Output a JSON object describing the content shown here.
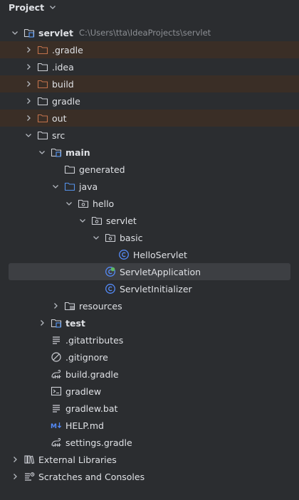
{
  "header": {
    "title": "Project"
  },
  "tree": [
    {
      "label": "servlet",
      "path": "C:\\Users\\tta\\IdeaProjects\\servlet",
      "icon": "module-folder-icon",
      "level": 0,
      "arrow": "open",
      "bold": true
    },
    {
      "label": ".gradle",
      "icon": "excluded-folder-icon",
      "level": 1,
      "arrow": "closed",
      "excluded": true
    },
    {
      "label": ".idea",
      "icon": "folder-icon",
      "level": 1,
      "arrow": "closed"
    },
    {
      "label": "build",
      "icon": "excluded-folder-icon",
      "level": 1,
      "arrow": "closed",
      "excluded": true
    },
    {
      "label": "gradle",
      "icon": "folder-icon",
      "level": 1,
      "arrow": "closed"
    },
    {
      "label": "out",
      "icon": "excluded-folder-icon",
      "level": 1,
      "arrow": "closed",
      "excluded": true
    },
    {
      "label": "src",
      "icon": "folder-icon",
      "level": 1,
      "arrow": "open"
    },
    {
      "label": "main",
      "icon": "module-folder-icon",
      "level": 2,
      "arrow": "open",
      "bold": true
    },
    {
      "label": "generated",
      "icon": "folder-icon",
      "level": 3,
      "arrow": "none"
    },
    {
      "label": "java",
      "icon": "source-folder-icon",
      "level": 3,
      "arrow": "open"
    },
    {
      "label": "hello",
      "icon": "package-icon",
      "level": 4,
      "arrow": "open"
    },
    {
      "label": "servlet",
      "icon": "package-icon",
      "level": 5,
      "arrow": "open"
    },
    {
      "label": "basic",
      "icon": "package-icon",
      "level": 6,
      "arrow": "open"
    },
    {
      "label": "HelloServlet",
      "icon": "class-icon",
      "level": 7,
      "arrow": "none"
    },
    {
      "label": "ServletApplication",
      "icon": "spring-boot-class-icon",
      "level": 6,
      "arrow": "none",
      "selected": true
    },
    {
      "label": "ServletInitializer",
      "icon": "class-icon",
      "level": 6,
      "arrow": "none"
    },
    {
      "label": "resources",
      "icon": "resources-folder-icon",
      "level": 3,
      "arrow": "closed"
    },
    {
      "label": "test",
      "icon": "module-folder-icon",
      "level": 2,
      "arrow": "closed",
      "bold": true
    },
    {
      "label": ".gitattributes",
      "icon": "text-file-icon",
      "level": 2,
      "arrow": "none"
    },
    {
      "label": ".gitignore",
      "icon": "gitignore-icon",
      "level": 2,
      "arrow": "none"
    },
    {
      "label": "build.gradle",
      "icon": "gradle-icon",
      "level": 2,
      "arrow": "none"
    },
    {
      "label": "gradlew",
      "icon": "terminal-file-icon",
      "level": 2,
      "arrow": "none"
    },
    {
      "label": "gradlew.bat",
      "icon": "text-file-icon",
      "level": 2,
      "arrow": "none"
    },
    {
      "label": "HELP.md",
      "icon": "markdown-icon",
      "level": 2,
      "arrow": "none"
    },
    {
      "label": "settings.gradle",
      "icon": "gradle-icon",
      "level": 2,
      "arrow": "none"
    },
    {
      "label": "External Libraries",
      "icon": "libraries-icon",
      "level": 0,
      "arrow": "closed"
    },
    {
      "label": "Scratches and Consoles",
      "icon": "scratches-icon",
      "level": 0,
      "arrow": "closed"
    }
  ],
  "colors": {
    "excluded_bg": "#3a2e26",
    "selected_bg": "#3d3f43",
    "excluded_folder": "#c2724c",
    "source_folder": "#5591e8",
    "class_icon": "#548af7",
    "spring_icon": "#5fb865"
  }
}
